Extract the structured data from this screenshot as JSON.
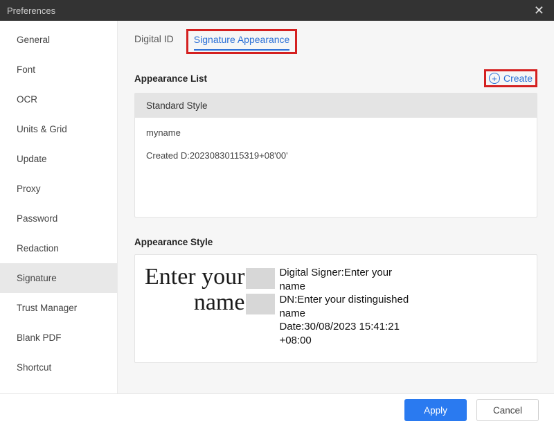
{
  "window": {
    "title": "Preferences"
  },
  "sidebar": {
    "items": [
      {
        "label": "General"
      },
      {
        "label": "Font"
      },
      {
        "label": "OCR"
      },
      {
        "label": "Units & Grid"
      },
      {
        "label": "Update"
      },
      {
        "label": "Proxy"
      },
      {
        "label": "Password"
      },
      {
        "label": "Redaction"
      },
      {
        "label": "Signature",
        "active": true
      },
      {
        "label": "Trust Manager"
      },
      {
        "label": "Blank PDF"
      },
      {
        "label": "Shortcut"
      }
    ]
  },
  "tabs": [
    {
      "label": "Digital ID"
    },
    {
      "label": "Signature Appearance",
      "active": true
    }
  ],
  "appearance": {
    "list_title": "Appearance List",
    "create_label": "Create",
    "header": "Standard Style",
    "item_name": "myname",
    "item_created": "Created D:20230830115319+08'00'"
  },
  "style": {
    "title": "Appearance Style",
    "left_line1": "Enter your",
    "left_line2": "name",
    "signer_line": "Digital Signer:Enter your name",
    "dn_line": "DN:Enter your distinguished name",
    "date_line": "Date:30/08/2023 15:41:21 +08:00"
  },
  "footer": {
    "apply": "Apply",
    "cancel": "Cancel"
  }
}
